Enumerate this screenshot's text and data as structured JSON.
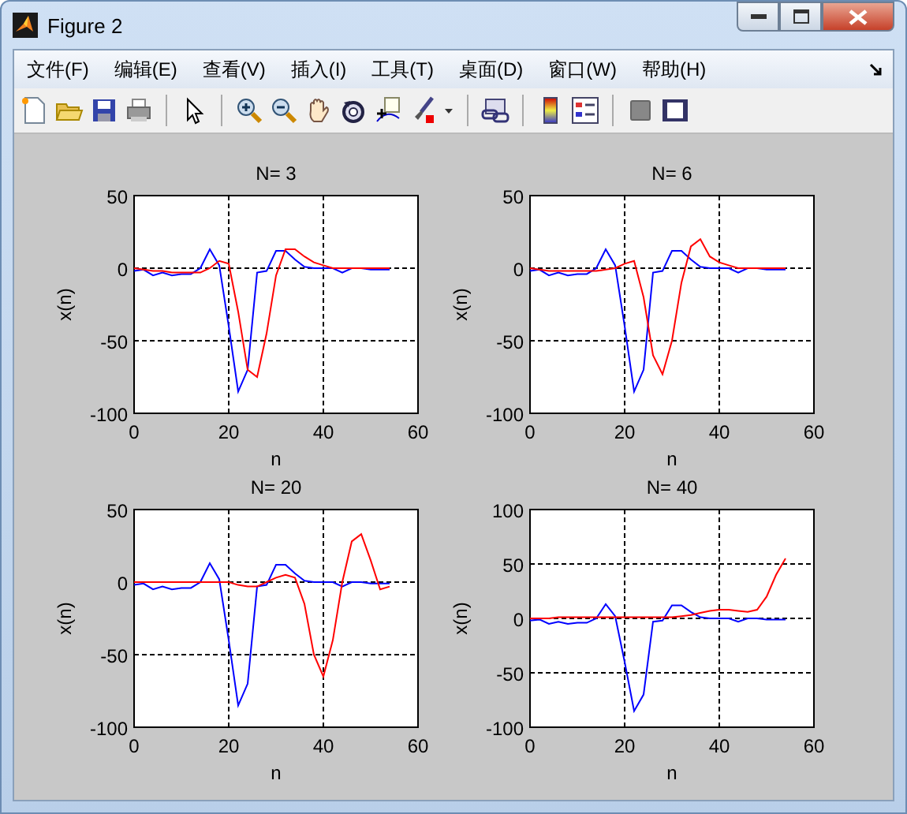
{
  "window": {
    "title": "Figure 2"
  },
  "menu": [
    "文件(F)",
    "编辑(E)",
    "查看(V)",
    "插入(I)",
    "工具(T)",
    "桌面(D)",
    "窗口(W)",
    "帮助(H)"
  ],
  "plots": [
    {
      "chart_data": {
        "type": "line",
        "title": "N= 3",
        "grid": true,
        "xlabel": "n",
        "ylabel": "x(n)",
        "x": [
          0,
          2,
          4,
          6,
          8,
          10,
          12,
          14,
          16,
          18,
          20,
          22,
          24,
          26,
          28,
          30,
          32,
          34,
          36,
          38,
          40,
          42,
          44,
          46,
          48,
          50,
          52,
          54
        ],
        "xlim": [
          0,
          60
        ],
        "ylim": [
          -100,
          50
        ],
        "xticks": [
          0,
          20,
          40,
          60
        ],
        "yticks": [
          -100,
          -50,
          0,
          50
        ],
        "series": [
          {
            "color": "#0000ff",
            "values": [
              -2,
              -1,
              -5,
              -3,
              -5,
              -4,
              -4,
              0,
              13,
              2,
              -40,
              -85,
              -70,
              -3,
              -2,
              12,
              12,
              6,
              1,
              0,
              0,
              0,
              -3,
              0,
              0,
              -1,
              -1,
              -1
            ]
          },
          {
            "color": "#ff0000",
            "values": [
              0,
              -1,
              -2,
              -2,
              -3,
              -3,
              -3,
              -3,
              0,
              5,
              3,
              -30,
              -70,
              -75,
              -45,
              -5,
              13,
              13,
              8,
              4,
              2,
              0,
              0,
              0,
              0,
              0,
              0,
              0
            ]
          }
        ]
      }
    },
    {
      "chart_data": {
        "type": "line",
        "title": "N= 6",
        "grid": true,
        "xlabel": "n",
        "ylabel": "x(n)",
        "x": [
          0,
          2,
          4,
          6,
          8,
          10,
          12,
          14,
          16,
          18,
          20,
          22,
          24,
          26,
          28,
          30,
          32,
          34,
          36,
          38,
          40,
          42,
          44,
          46,
          48,
          50,
          52,
          54
        ],
        "xlim": [
          0,
          60
        ],
        "ylim": [
          -100,
          50
        ],
        "xticks": [
          0,
          20,
          40,
          60
        ],
        "yticks": [
          -100,
          -50,
          0,
          50
        ],
        "series": [
          {
            "color": "#0000ff",
            "values": [
              -2,
              -1,
              -5,
              -3,
              -5,
              -4,
              -4,
              0,
              13,
              2,
              -40,
              -85,
              -70,
              -3,
              -2,
              12,
              12,
              6,
              1,
              0,
              0,
              0,
              -3,
              0,
              0,
              -1,
              -1,
              -1
            ]
          },
          {
            "color": "#ff0000",
            "values": [
              0,
              -1,
              -2,
              -2,
              -2,
              -2,
              -2,
              -2,
              -1,
              0,
              3,
              5,
              -20,
              -60,
              -73,
              -50,
              -10,
              15,
              20,
              8,
              4,
              2,
              0,
              0,
              0,
              0,
              0,
              0
            ]
          }
        ]
      }
    },
    {
      "chart_data": {
        "type": "line",
        "title": "N= 20",
        "grid": true,
        "xlabel": "n",
        "ylabel": "x(n)",
        "x": [
          0,
          2,
          4,
          6,
          8,
          10,
          12,
          14,
          16,
          18,
          20,
          22,
          24,
          26,
          28,
          30,
          32,
          34,
          36,
          38,
          40,
          42,
          44,
          46,
          48,
          50,
          52,
          54
        ],
        "xlim": [
          0,
          60
        ],
        "ylim": [
          -100,
          50
        ],
        "xticks": [
          0,
          20,
          40,
          60
        ],
        "yticks": [
          -100,
          -50,
          0,
          50
        ],
        "series": [
          {
            "color": "#0000ff",
            "values": [
              -2,
              -1,
              -5,
              -3,
              -5,
              -4,
              -4,
              0,
              13,
              2,
              -40,
              -85,
              -70,
              -3,
              -2,
              12,
              12,
              6,
              1,
              0,
              0,
              0,
              -3,
              0,
              0,
              -1,
              -1,
              -1
            ]
          },
          {
            "color": "#ff0000",
            "values": [
              0,
              0,
              0,
              0,
              0,
              0,
              0,
              0,
              0,
              0,
              0,
              -2,
              -3,
              -3,
              0,
              3,
              5,
              3,
              -15,
              -50,
              -65,
              -40,
              0,
              28,
              33,
              15,
              -5,
              -3
            ]
          }
        ]
      }
    },
    {
      "chart_data": {
        "type": "line",
        "title": "N= 40",
        "grid": true,
        "xlabel": "n",
        "ylabel": "x(n)",
        "x": [
          0,
          2,
          4,
          6,
          8,
          10,
          12,
          14,
          16,
          18,
          20,
          22,
          24,
          26,
          28,
          30,
          32,
          34,
          36,
          38,
          40,
          42,
          44,
          46,
          48,
          50,
          52,
          54
        ],
        "xlim": [
          0,
          60
        ],
        "ylim": [
          -100,
          100
        ],
        "xticks": [
          0,
          20,
          40,
          60
        ],
        "yticks": [
          -100,
          -50,
          0,
          50,
          100
        ],
        "series": [
          {
            "color": "#0000ff",
            "values": [
              -2,
              -1,
              -5,
              -3,
              -5,
              -4,
              -4,
              0,
              13,
              2,
              -40,
              -85,
              -70,
              -3,
              -2,
              12,
              12,
              6,
              1,
              0,
              0,
              0,
              -3,
              0,
              0,
              -1,
              -1,
              -1
            ]
          },
          {
            "color": "#ff0000",
            "values": [
              0,
              0,
              0,
              1,
              1,
              1,
              1,
              1,
              1,
              1,
              1,
              1,
              1,
              1,
              1,
              1,
              2,
              3,
              5,
              7,
              8,
              8,
              7,
              6,
              8,
              20,
              40,
              55
            ]
          }
        ]
      }
    }
  ]
}
